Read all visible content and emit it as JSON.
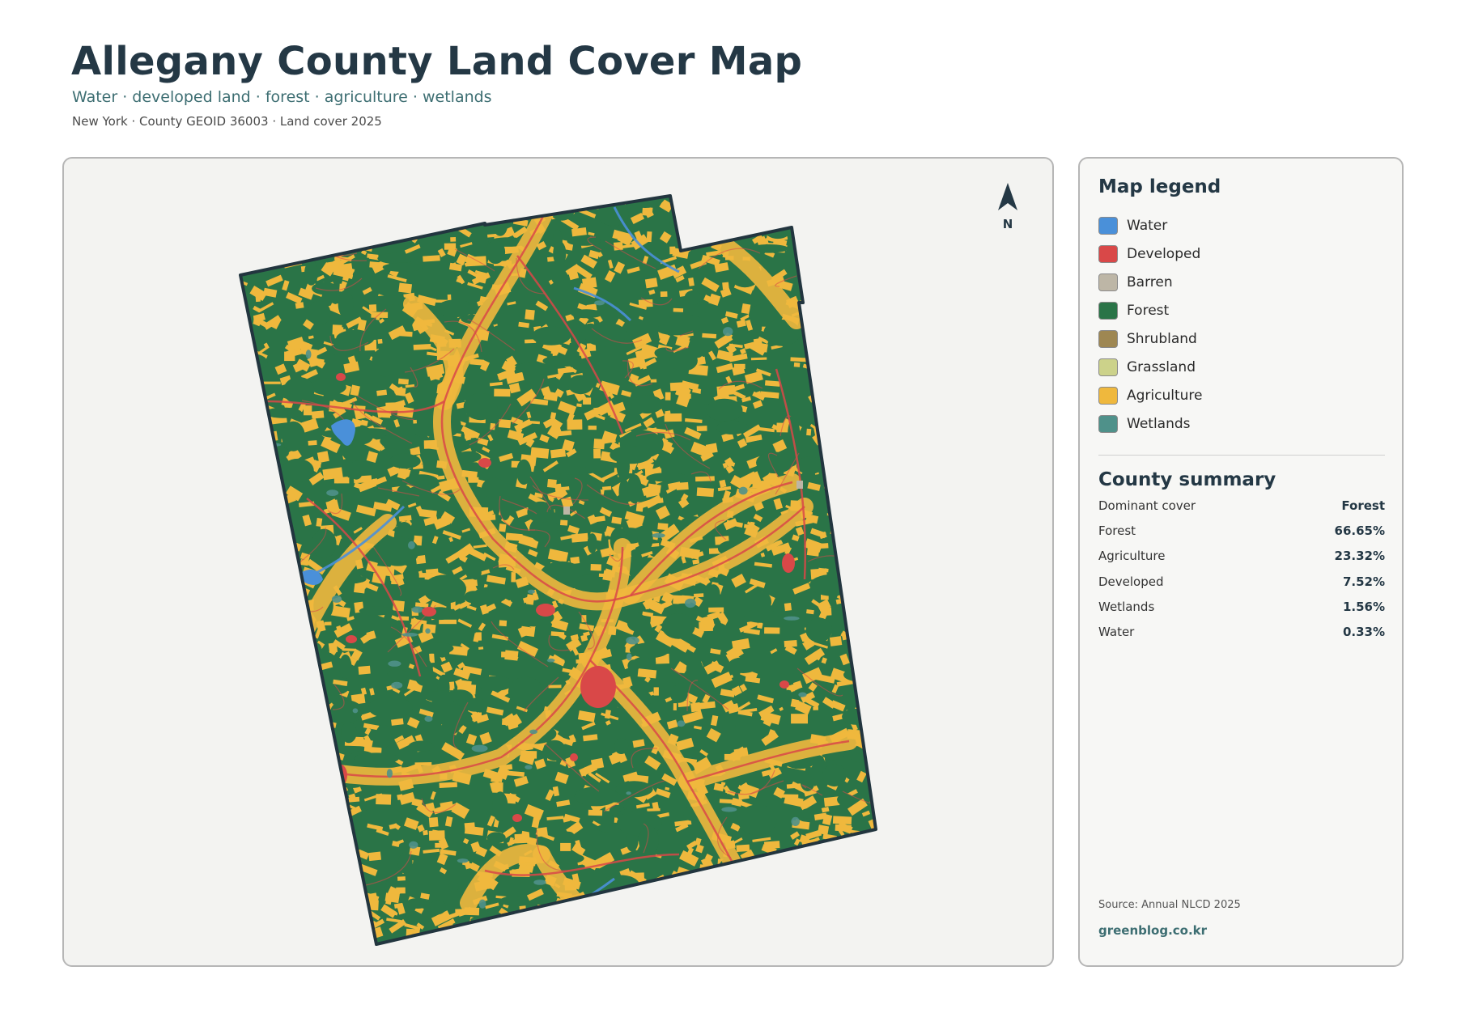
{
  "title": "Allegany County Land Cover Map",
  "subtitle": "Water · developed land · forest · agriculture · wetlands",
  "meta": "New York · County GEOID 36003 · Land cover 2025",
  "north_label": "N",
  "legend": {
    "heading": "Map legend",
    "items": [
      {
        "label": "Water",
        "color": "#4a90d9"
      },
      {
        "label": "Developed",
        "color": "#d94848"
      },
      {
        "label": "Barren",
        "color": "#bdb6a6"
      },
      {
        "label": "Forest",
        "color": "#2a7447"
      },
      {
        "label": "Shrubland",
        "color": "#9e8752"
      },
      {
        "label": "Grassland",
        "color": "#ccd28a"
      },
      {
        "label": "Agriculture",
        "color": "#efb83d"
      },
      {
        "label": "Wetlands",
        "color": "#4f918a"
      }
    ]
  },
  "summary": {
    "heading": "County summary",
    "rows": [
      {
        "key": "Dominant cover",
        "value": "Forest"
      },
      {
        "key": "Forest",
        "value": "66.65%"
      },
      {
        "key": "Agriculture",
        "value": "23.32%"
      },
      {
        "key": "Developed",
        "value": "7.52%"
      },
      {
        "key": "Wetlands",
        "value": "1.56%"
      },
      {
        "key": "Water",
        "value": "0.33%"
      }
    ]
  },
  "source": "Source: Annual NLCD 2025",
  "site": "greenblog.co.kr",
  "colors": {
    "forest": "#2a7447",
    "agriculture": "#efb83d",
    "developed": "#d94848",
    "water": "#4a90d9",
    "wetlands": "#4f918a",
    "barren": "#bdb6a6",
    "boundary": "#22353f"
  }
}
